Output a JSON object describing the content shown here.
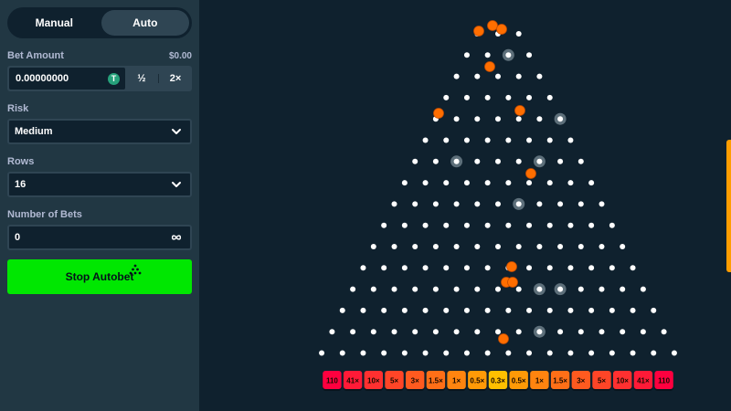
{
  "sidebar": {
    "tabs": [
      {
        "label": "Manual",
        "active": false
      },
      {
        "label": "Auto",
        "active": true
      }
    ],
    "bet_amount": {
      "label": "Bet Amount",
      "usd": "$0.00",
      "value": "0.00000000",
      "currency_icon": "tether-icon",
      "currency_symbol": "T",
      "half_label": "½",
      "double_label": "2×"
    },
    "risk": {
      "label": "Risk",
      "value": "Medium"
    },
    "rows": {
      "label": "Rows",
      "value": "16"
    },
    "number_of_bets": {
      "label": "Number of Bets",
      "value": "0",
      "icon": "infinity-icon"
    },
    "action_button": {
      "label": "Stop Autobet"
    }
  },
  "board": {
    "rows": 16,
    "multipliers": [
      "110",
      "41×",
      "10×",
      "5×",
      "3×",
      "1.5×",
      "1×",
      "0.5×",
      "0.3×",
      "0.5×",
      "1×",
      "1.5×",
      "3×",
      "5×",
      "10×",
      "41×",
      "110"
    ],
    "bucket_colors": [
      "#ff003f",
      "#ff1a37",
      "#ff3030",
      "#ff4527",
      "#ff5a1f",
      "#ff6f17",
      "#ff840f",
      "#ff9a07",
      "#ffc000",
      "#ff9a07",
      "#ff840f",
      "#ff6f17",
      "#ff5a1f",
      "#ff4527",
      "#ff3030",
      "#ff1a37",
      "#ff003f"
    ],
    "balls_in_flight": 11
  },
  "colors": {
    "accent_green": "#00e701",
    "ball_orange": "#ff6e00",
    "peg_white": "#ffffff",
    "panel": "#213743",
    "background": "#0f212e"
  }
}
